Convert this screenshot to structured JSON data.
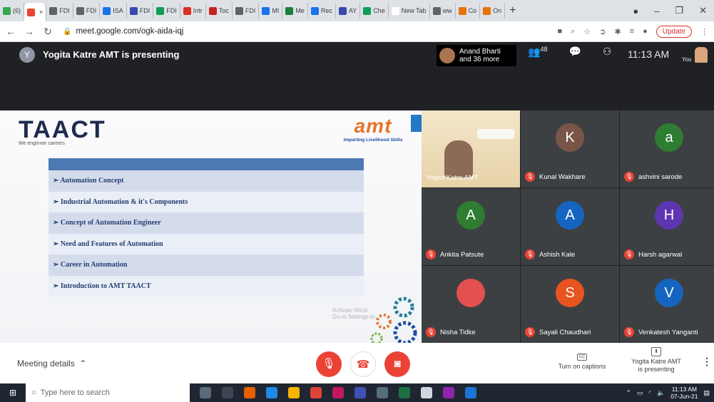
{
  "browser": {
    "tabs": [
      {
        "label": "(6)",
        "color": "#34a853"
      },
      {
        "label": "",
        "color": "#ea4335",
        "active": true
      },
      {
        "label": "FDI",
        "color": "#5f6368"
      },
      {
        "label": "FDI",
        "color": "#5f6368"
      },
      {
        "label": "ISA",
        "color": "#1a73e8"
      },
      {
        "label": "FDI",
        "color": "#3949ab"
      },
      {
        "label": "FDI",
        "color": "#0f9d58"
      },
      {
        "label": "Intr",
        "color": "#d93025"
      },
      {
        "label": "Toc",
        "color": "#c5221f"
      },
      {
        "label": "FDI",
        "color": "#5f6368"
      },
      {
        "label": "MI",
        "color": "#1a73e8"
      },
      {
        "label": "Me",
        "color": "#188038"
      },
      {
        "label": "Rec",
        "color": "#1a73e8"
      },
      {
        "label": "AY",
        "color": "#3949ab"
      },
      {
        "label": "Che",
        "color": "#0f9d58"
      },
      {
        "label": "New Tab",
        "color": "#ffffff"
      },
      {
        "label": "ww",
        "color": "#5f6368"
      },
      {
        "label": "Co",
        "color": "#e8710a"
      },
      {
        "label": "On",
        "color": "#e8710a"
      }
    ],
    "new_tab": "+",
    "url": "meet.google.com/ogk-aida-iqj",
    "update_label": "Update"
  },
  "meet": {
    "presenter_initial": "Y",
    "presenting_title": "Yogita Katre AMT is presenting",
    "people_chip": {
      "line1": "Anand Bharti",
      "line2": "and 36 more"
    },
    "participants_count": "48",
    "time": "11:13 AM",
    "you_label": "You"
  },
  "slide": {
    "logo_left": "TAACT",
    "logo_left_tag": "We enginner careers",
    "logo_right": "amt",
    "logo_right_tag": "Imparting Livelihood Skills",
    "topics": [
      "➢ Automation Concept",
      "➢ Industrial Automation & it's Components",
      "➢ Concept of Automation Engineer",
      "➢ Need and Features of Automation",
      "➢ Career in Automation",
      "➢ Introduction to AMT TAACT"
    ],
    "watermark_line1": "Activate Wind",
    "watermark_line2": "Go to Settings to"
  },
  "participants": [
    {
      "name": "Yogita Katre AMT",
      "type": "camera"
    },
    {
      "name": "Kunal Wakhare",
      "initial": "K",
      "color": "#795548"
    },
    {
      "name": "ashvini sarode",
      "initial": "a",
      "color": "#2e7d32"
    },
    {
      "name": "Ankita Patsute",
      "initial": "A",
      "color": "#2e7d32"
    },
    {
      "name": "Ashish Kale",
      "initial": "A",
      "color": "#1565c0"
    },
    {
      "name": "Harsh agarwal",
      "initial": "H",
      "color": "#5e35b1"
    },
    {
      "name": "Nisha Tidke",
      "type": "photo"
    },
    {
      "name": "Sayali Chaudhari",
      "initial": "S",
      "color": "#e8541f"
    },
    {
      "name": "Venkatesh Yanganti",
      "initial": "V",
      "color": "#1565c0"
    }
  ],
  "controls": {
    "meeting_details": "Meeting details",
    "captions_label": "Turn on captions",
    "captions_icon": "CC",
    "present_line1": "Yogita Katre AMT",
    "present_line2": "is presenting"
  },
  "taskbar": {
    "search_placeholder": "Type here to search",
    "time": "11:13 AM",
    "date": "07-Jun-21"
  }
}
